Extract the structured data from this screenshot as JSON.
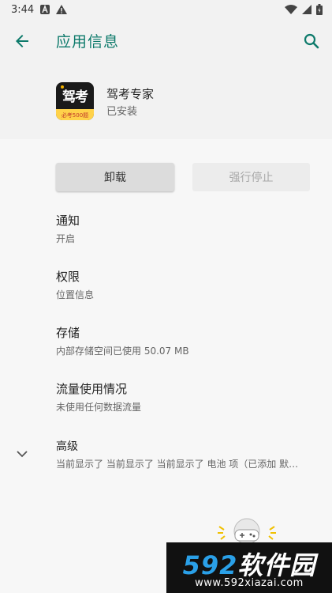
{
  "status_bar": {
    "time": "3:44",
    "icons": [
      "notification-a-icon",
      "warning-icon",
      "wifi-icon",
      "cellular-icon",
      "battery-icon"
    ]
  },
  "app_bar": {
    "title": "应用信息",
    "back_icon": "back-arrow-icon",
    "search_icon": "search-icon"
  },
  "app": {
    "icon_text": "驾考",
    "icon_band_text": "必考500题",
    "name": "驾考专家",
    "status": "已安装"
  },
  "buttons": {
    "uninstall": "卸载",
    "force_stop": "强行停止"
  },
  "prefs": [
    {
      "title": "通知",
      "summary": "开启"
    },
    {
      "title": "权限",
      "summary": "位置信息"
    },
    {
      "title": "存储",
      "summary": "内部存储空间已使用 50.07 MB"
    },
    {
      "title": "流量使用情况",
      "summary": "未使用任何数据流量"
    },
    {
      "title": "高级",
      "summary": "当前显示了 当前显示了 当前显示了 电池 项（已添加 默…"
    }
  ],
  "watermark": {
    "brand_num": "592",
    "brand_cn": "软件园",
    "url": "www.592xiazai.com"
  },
  "colors": {
    "accent": "#0d7a6b",
    "background": "#f2f2f2"
  }
}
